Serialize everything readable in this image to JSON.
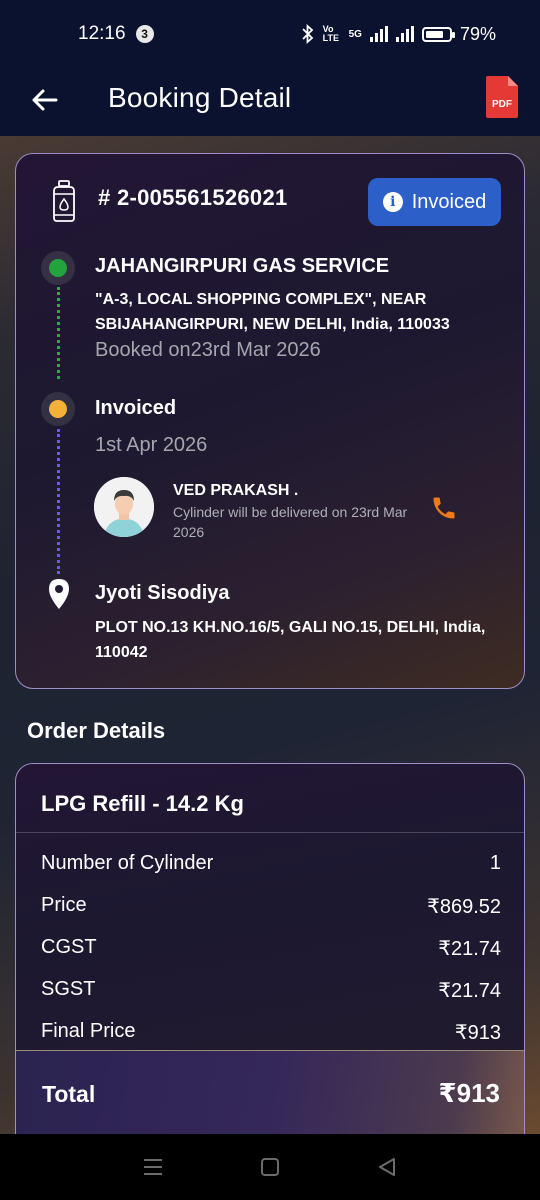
{
  "status_bar": {
    "time": "12:16",
    "notification_count": "3",
    "network_label": "Vo LTE",
    "network_5g": "5G",
    "battery": "79%",
    "battery_level": 0.79
  },
  "app_bar": {
    "title": "Booking Detail",
    "back_icon": "arrow-left-icon",
    "pdf_label": "PDF"
  },
  "booking": {
    "number": "# 2-005561526021",
    "status_label": "Invoiced",
    "status_color": "#2d5fc8",
    "distributor": {
      "name": "JAHANGIRPURI GAS SERVICE",
      "address": "\"A-3, LOCAL SHOPPING COMPLEX\", NEAR SBIJAHANGIRPURI, NEW DELHI, India, 110033",
      "booked_on": "Booked on23rd Mar 2026"
    },
    "invoice": {
      "label": "Invoiced",
      "date": "1st Apr 2026"
    },
    "delivery_person": {
      "name": "VED PRAKASH .",
      "note": "Cylinder will be delivered on 23rd Mar 2026"
    },
    "customer": {
      "name": "Jyoti Sisodiya",
      "address": "PLOT NO.13 KH.NO.16/5, GALI NO.15, DELHI, India, 110042"
    }
  },
  "order_details": {
    "section_title": "Order Details",
    "product": "LPG Refill - 14.2 Kg",
    "rows": [
      {
        "label": "Number of Cylinder",
        "value": "1"
      },
      {
        "label": "Price",
        "value": "₹869.52"
      },
      {
        "label": "CGST",
        "value": "₹21.74"
      },
      {
        "label": "SGST",
        "value": "₹21.74"
      },
      {
        "label": "Final Price",
        "value": "₹913"
      }
    ],
    "total_label": "Total",
    "total_value": "₹913"
  },
  "colors": {
    "accent_green": "#21a33d",
    "accent_yellow": "#f4b13a",
    "phone_orange": "#f07a1a",
    "pdf_red": "#e53935"
  }
}
